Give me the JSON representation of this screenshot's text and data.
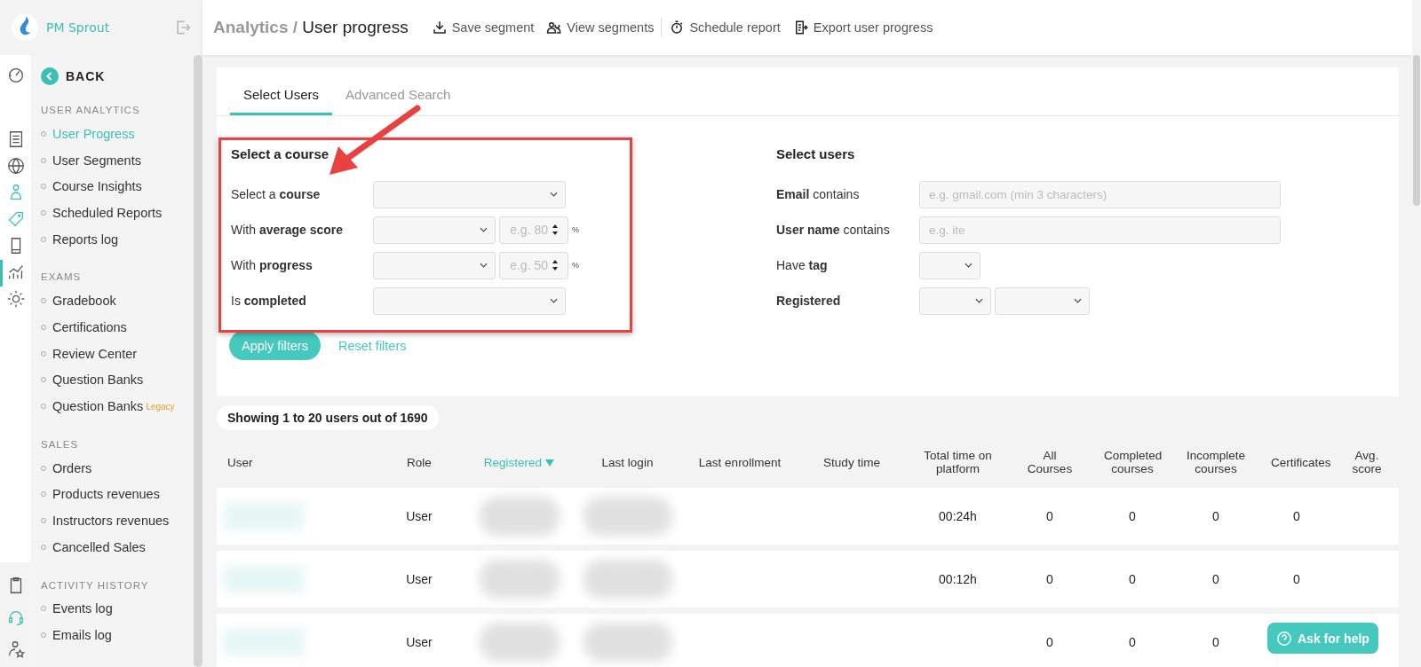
{
  "brand": {
    "name": "PM Sprout"
  },
  "rail": [
    {
      "kind": "gauge",
      "selected": false
    },
    {
      "kind": "list",
      "selected": false
    },
    {
      "kind": "globe",
      "selected": false
    },
    {
      "kind": "person",
      "selected": false
    },
    {
      "kind": "tag",
      "selected": false
    },
    {
      "kind": "phone",
      "selected": false
    },
    {
      "kind": "chart",
      "selected": true
    },
    {
      "kind": "gear",
      "selected": false
    }
  ],
  "rail_bottom": [
    {
      "kind": "clipboard"
    },
    {
      "kind": "headset"
    },
    {
      "kind": "person-star"
    }
  ],
  "back": "BACK",
  "sections": [
    {
      "title": "USER ANALYTICS",
      "items": [
        {
          "label": "User Progress",
          "selected": true
        },
        {
          "label": "User Segments",
          "selected": false
        },
        {
          "label": "Course Insights",
          "selected": false
        },
        {
          "label": "Scheduled Reports",
          "selected": false
        },
        {
          "label": "Reports log",
          "selected": false
        }
      ]
    },
    {
      "title": "EXAMS",
      "items": [
        {
          "label": "Gradebook",
          "selected": false
        },
        {
          "label": "Certifications",
          "selected": false
        },
        {
          "label": "Review Center",
          "selected": false
        },
        {
          "label": "Question Banks",
          "selected": false
        },
        {
          "label": "Question Banks",
          "badge": "Legacy",
          "selected": false
        }
      ]
    },
    {
      "title": "SALES",
      "items": [
        {
          "label": "Orders",
          "selected": false
        },
        {
          "label": "Products revenues",
          "selected": false
        },
        {
          "label": "Instructors revenues",
          "selected": false
        },
        {
          "label": "Cancelled Sales",
          "selected": false
        }
      ]
    },
    {
      "title": "ACTIVITY HISTORY",
      "items": [
        {
          "label": "Events log",
          "selected": false
        },
        {
          "label": "Emails log",
          "selected": false
        }
      ]
    }
  ],
  "breadcrumb": {
    "parent": "Analytics /",
    "current": "User progress"
  },
  "actions": [
    {
      "kind": "download",
      "label": "Save segment"
    },
    {
      "kind": "people",
      "label": "View segments"
    },
    {
      "kind": "timer",
      "label": "Schedule report"
    },
    {
      "kind": "export",
      "label": "Export user progress"
    }
  ],
  "tabs": [
    {
      "label": "Select Users",
      "selected": true
    },
    {
      "label": "Advanced Search",
      "selected": false
    }
  ],
  "course_filters": {
    "title": "Select a course",
    "fields": [
      {
        "label": "Select a **course**",
        "kind": "select"
      },
      {
        "label": "With **average score**",
        "kind": "select-number",
        "placeholder": "e.g. 80",
        "unit": "%"
      },
      {
        "label": "With **progress**",
        "kind": "select-number",
        "placeholder": "e.g. 50",
        "unit": "%"
      },
      {
        "label": "Is **completed**",
        "kind": "select"
      }
    ]
  },
  "user_filters": {
    "title": "Select users",
    "fields": [
      {
        "label": "**Email** contains",
        "kind": "text",
        "placeholder": "e.g. gmail.com (min 3 characters)"
      },
      {
        "label": "**User name** contains",
        "kind": "text",
        "placeholder": "e.g. ite"
      },
      {
        "label": "Have **tag**",
        "kind": "small-select"
      },
      {
        "label": "Registered",
        "bold": true,
        "kind": "double-select"
      }
    ]
  },
  "apply_button": "Apply filters",
  "reset_link": "Reset filters",
  "result_count": "Showing 1 to 20 users out of 1690",
  "table": {
    "columns": [
      {
        "label": "User",
        "sorted": false
      },
      {
        "label": "Role",
        "sorted": false
      },
      {
        "label": "Registered",
        "sorted": true
      },
      {
        "label": "Last login",
        "sorted": false
      },
      {
        "label": "Last enrollment",
        "sorted": false
      },
      {
        "label": "Study time",
        "sorted": false
      },
      {
        "label": "Total time on platform",
        "sorted": false
      },
      {
        "label": "All Courses",
        "sorted": false
      },
      {
        "label": "Completed courses",
        "sorted": false
      },
      {
        "label": "Incomplete courses",
        "sorted": false
      },
      {
        "label": "Certificates",
        "sorted": false
      },
      {
        "label": "Avg. score",
        "sorted": false
      }
    ],
    "rows": [
      {
        "role": "User",
        "total_time": "00:24h",
        "all_courses": "0",
        "completed": "0",
        "incomplete": "0",
        "certificates": "0"
      },
      {
        "role": "User",
        "total_time": "00:12h",
        "all_courses": "0",
        "completed": "0",
        "incomplete": "0",
        "certificates": "0"
      },
      {
        "role": "User",
        "all_courses": "0",
        "completed": "0",
        "incomplete": "0"
      }
    ]
  },
  "help_button": "Ask for help"
}
